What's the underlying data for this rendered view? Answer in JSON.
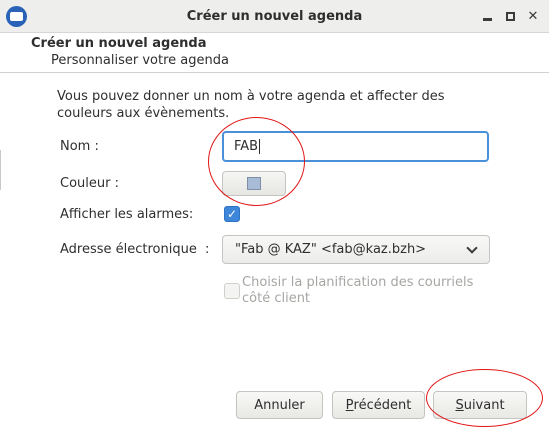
{
  "window": {
    "title": "Créer un nouvel agenda",
    "app_icon": "thunderbird-icon",
    "controls": {
      "minimize_icon": "minimize-icon",
      "maximize_icon": "maximize-icon",
      "close_icon": "close-icon",
      "close_glyph": "✕"
    }
  },
  "header": {
    "title": "Créer un nouvel agenda",
    "subtitle": "Personnaliser votre agenda"
  },
  "form": {
    "intro": "Vous pouvez donner un nom à votre agenda et affecter des couleurs aux évènements.",
    "name_label": "Nom :",
    "name_value": "FAB",
    "color_label": "Couleur :",
    "color_value": "#a8bcd8",
    "alarms_label": "Afficher les alarmes:",
    "alarms_checked": true,
    "alarms_glyph": "✓",
    "email_label": "Adresse électronique",
    "email_separator": ":",
    "email_value": "\"Fab @ KAZ\" <fab@kaz.bzh>",
    "client_scheduling_label": "Choisir la planification des courriels côté client",
    "client_scheduling_checked": false,
    "client_scheduling_enabled": false
  },
  "buttons": {
    "cancel": "Annuler",
    "previous_mnemonic": "P",
    "previous_rest": "récédent",
    "next_mnemonic": "S",
    "next_rest": "uivant"
  },
  "colors": {
    "accent": "#3d86d9",
    "focus_border": "#4a90d9",
    "annotation": "#e01515",
    "disabled_text": "#a6a6a3"
  }
}
